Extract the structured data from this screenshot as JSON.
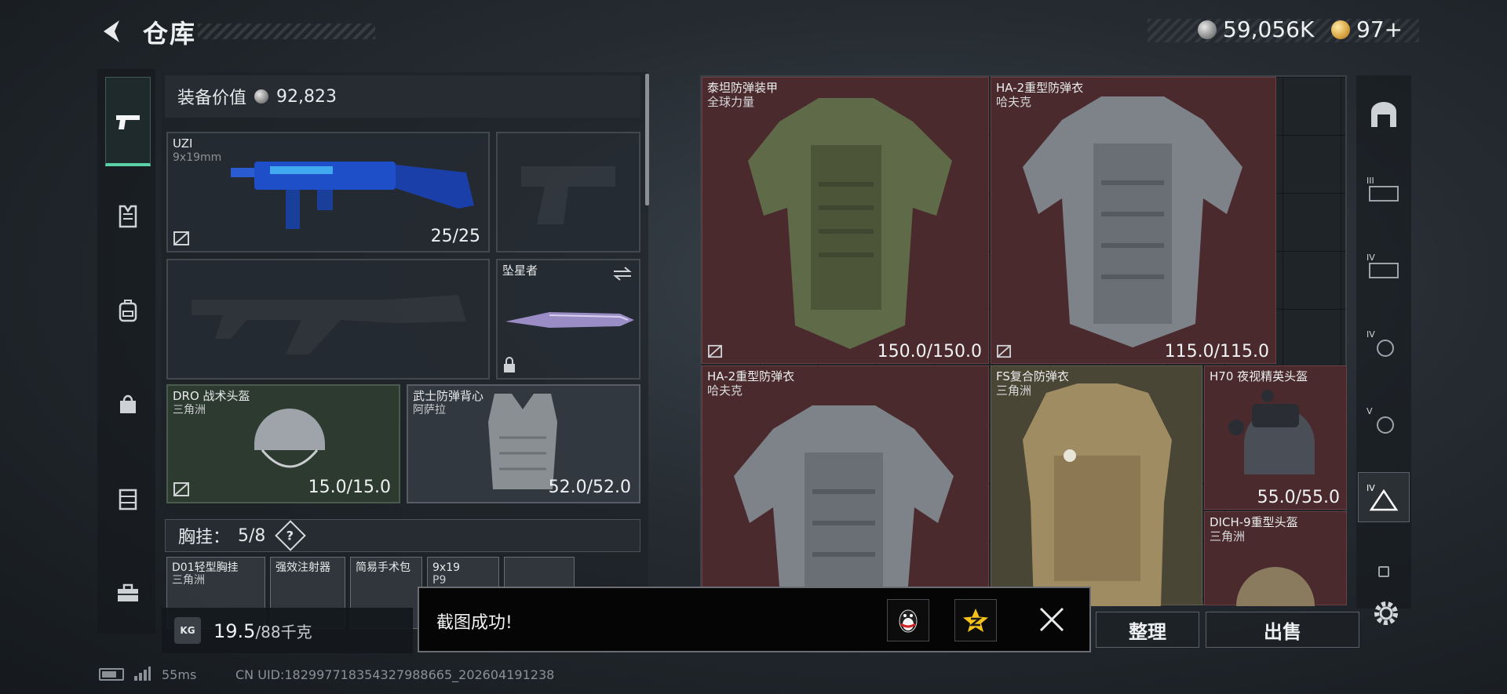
{
  "header": {
    "title": "仓库",
    "currency_silver": "59,056K",
    "currency_gold": "97+"
  },
  "loadout": {
    "value_label": "装备价值",
    "value": "92,823",
    "primary": {
      "name": "UZI",
      "caliber": "9x19mm",
      "ammo": "25/25"
    },
    "melee": {
      "name": "坠星者"
    },
    "helmet": {
      "name": "DRO 战术头盔",
      "origin": "三角洲",
      "durability": "15.0/15.0"
    },
    "armor": {
      "name": "武士防弹背心",
      "origin": "阿萨拉",
      "durability": "52.0/52.0"
    },
    "chest_rig": {
      "label": "胸挂：",
      "count": "5/8",
      "help": "?"
    },
    "rig_items": [
      {
        "name": "D01轻型胸挂",
        "origin": "三角洲"
      },
      {
        "name": "强效注射器"
      },
      {
        "name": "简易手术包"
      },
      {
        "name": "9x19",
        "sub": "P9"
      }
    ],
    "weight": {
      "value": "19.5",
      "max": "/88千克",
      "icon_text": "KG"
    }
  },
  "storage_items": [
    {
      "name": "泰坦防弹装甲",
      "origin": "全球力量",
      "durability": "150.0/150.0"
    },
    {
      "name": "HA-2重型防弹衣",
      "origin": "哈夫克",
      "durability": "115.0/115.0"
    },
    {
      "name": "HA-2重型防弹衣",
      "origin": "哈夫克"
    },
    {
      "name": "FS复合防弹衣",
      "origin": "三角洲"
    },
    {
      "name": "H70 夜视精英头盔",
      "durability": "55.0/55.0"
    },
    {
      "name": "DICH-9重型头盔",
      "origin": "三角洲"
    }
  ],
  "buttons": {
    "sort": "整理",
    "sell": "出售"
  },
  "toast": {
    "message": "截图成功!"
  },
  "status": {
    "ping": "55ms",
    "uid": "CN UID:1829977183543279886​65_202604191238"
  },
  "right_sidebar": {
    "tier_labels": [
      "III",
      "IV",
      "IV",
      "V",
      "IV"
    ]
  },
  "colors": {
    "accent": "#5ad2a6",
    "item_red": "#4a2a2d",
    "item_tan": "#4a4636"
  }
}
